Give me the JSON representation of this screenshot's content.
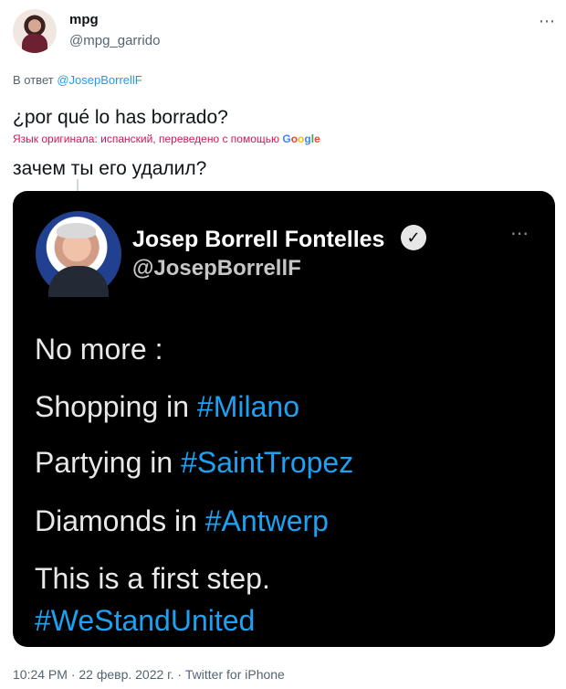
{
  "tweet": {
    "author_name": "mpg",
    "author_handle": "@mpg_garrido",
    "more_icon": "⋯",
    "reply_prefix": "В ответ",
    "reply_to": "@JosepBorrellF",
    "text": "¿por qué lo has borrado?",
    "translation_note": "Язык оригинала: испанский, переведено с помощью",
    "translation_brand": [
      "G",
      "o",
      "o",
      "g",
      "l",
      "e"
    ],
    "translated_text": "зачем ты его удалил?",
    "meta": "10:24 PM · 22 февр. 2022 г. · Twitter for iPhone"
  },
  "embedded": {
    "name": "Josep Borrell Fontelles",
    "handle": "@JosepBorrellF",
    "verified_icon": "✓",
    "more_icon": "⋯",
    "lines": [
      {
        "plain": "No more :",
        "tag": ""
      },
      {
        "plain": "Shopping in ",
        "tag": "#Milano"
      },
      {
        "plain": "Partying in ",
        "tag": "#SaintTropez"
      },
      {
        "plain": "Diamonds in ",
        "tag": "#Antwerp"
      },
      {
        "plain": "This is a first step.",
        "tag": ""
      },
      {
        "plain": "",
        "tag": "#WeStandUnited"
      }
    ]
  }
}
